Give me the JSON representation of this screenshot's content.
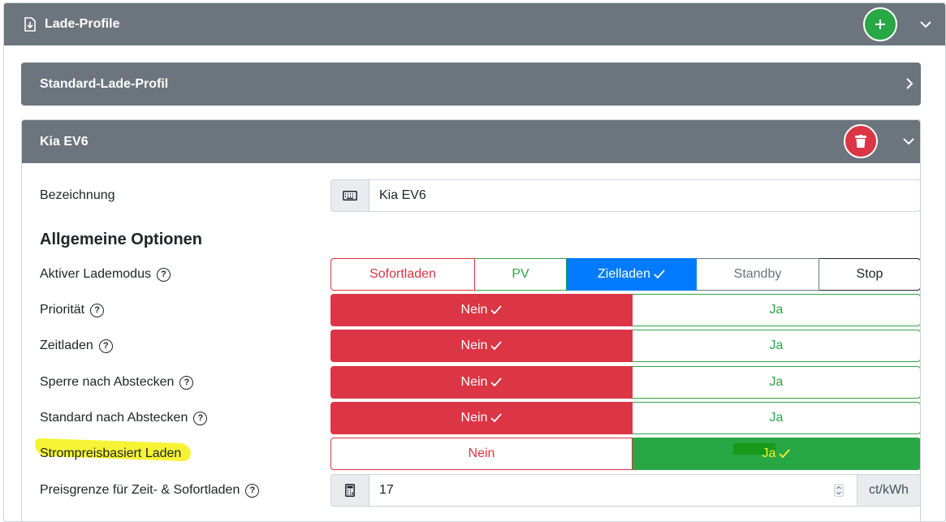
{
  "outer": {
    "title": "Lade-Profile"
  },
  "profile_collapsed": {
    "title": "Standard-Lade-Profil"
  },
  "profile": {
    "title": "Kia EV6",
    "bezeichnung": {
      "label": "Bezeichnung",
      "value": "Kia EV6"
    },
    "section_title": "Allgemeine Optionen",
    "lademodus": {
      "label": "Aktiver Lademodus",
      "options": [
        "Sofortladen",
        "PV",
        "Zielladen",
        "Standby",
        "Stop"
      ],
      "selected": "Zielladen"
    },
    "toggles": [
      {
        "label": "Priorität",
        "no": "Nein",
        "yes": "Ja",
        "selected": "Nein"
      },
      {
        "label": "Zeitladen",
        "no": "Nein",
        "yes": "Ja",
        "selected": "Nein"
      },
      {
        "label": "Sperre nach Abstecken",
        "no": "Nein",
        "yes": "Ja",
        "selected": "Nein"
      },
      {
        "label": "Standard nach Abstecken",
        "no": "Nein",
        "yes": "Ja",
        "selected": "Nein"
      },
      {
        "label": "Strompreisbasiert Laden",
        "no": "Nein",
        "yes": "Ja",
        "selected": "Ja"
      }
    ],
    "preisgrenze": {
      "label": "Preisgrenze für Zeit- & Sofortladen",
      "value": "17",
      "unit": "ct/kWh"
    }
  },
  "colors": {
    "header": "#6c757d",
    "danger": "#dc3545",
    "success": "#28a745",
    "primary": "#007bff",
    "highlight": "#f5f22a"
  }
}
